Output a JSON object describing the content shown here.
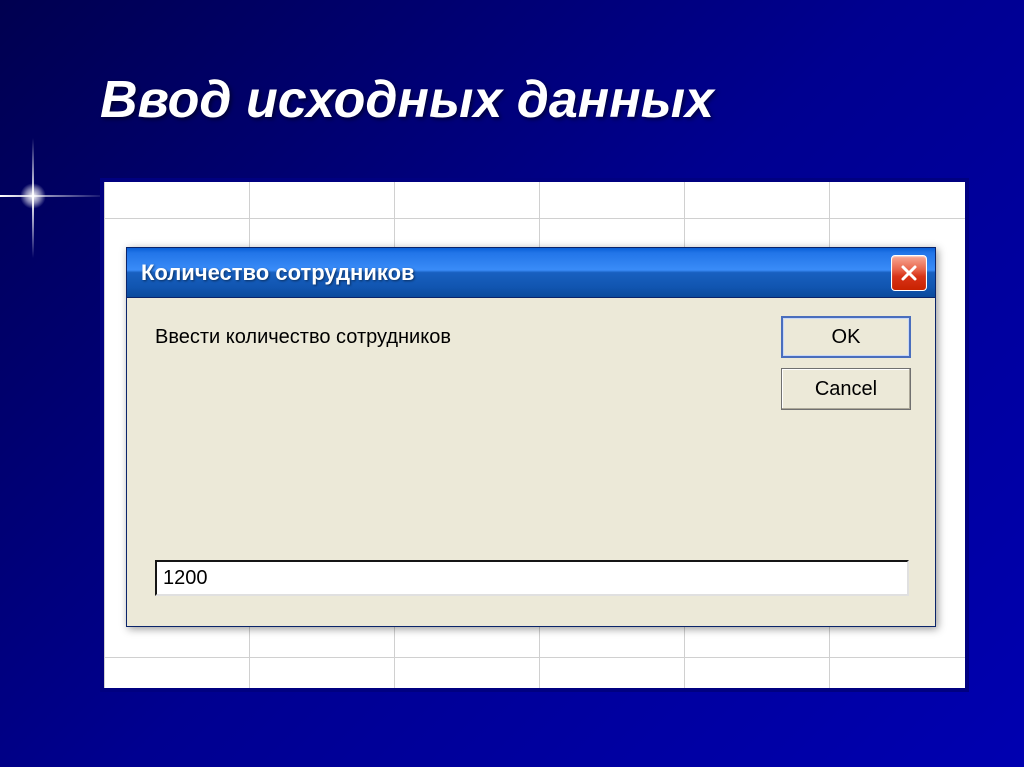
{
  "slide": {
    "title": "Ввод исходных данных"
  },
  "dialog": {
    "title": "Количество сотрудников",
    "prompt": "Ввести количество сотрудников",
    "input_value": "1200",
    "buttons": {
      "ok": "OK",
      "cancel": "Cancel"
    }
  }
}
